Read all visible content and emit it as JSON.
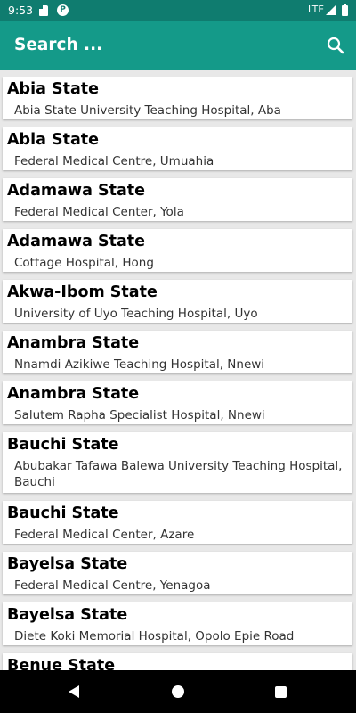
{
  "status_bar": {
    "time": "9:53",
    "network": "LTE",
    "icons": [
      "sd-card-icon",
      "p-notification-icon",
      "signal-icon",
      "battery-icon"
    ]
  },
  "app_bar": {
    "search_placeholder": "Search ...",
    "search_icon": "search-icon",
    "color": "#149a89"
  },
  "hospitals": [
    {
      "state": "Abia State",
      "hospital": "Abia State University Teaching Hospital, Aba"
    },
    {
      "state": "Abia State",
      "hospital": "Federal Medical Centre, Umuahia"
    },
    {
      "state": "Adamawa State",
      "hospital": "Federal Medical Center, Yola"
    },
    {
      "state": "Adamawa State",
      "hospital": "Cottage Hospital, Hong"
    },
    {
      "state": "Akwa-Ibom State",
      "hospital": "University of Uyo Teaching Hospital, Uyo"
    },
    {
      "state": "Anambra State",
      "hospital": "Nnamdi Azikiwe Teaching Hospital, Nnewi"
    },
    {
      "state": "Anambra State",
      "hospital": "Salutem Rapha Specialist Hospital, Nnewi"
    },
    {
      "state": "Bauchi State",
      "hospital": "Abubakar Tafawa Balewa University Teaching Hospital, Bauchi"
    },
    {
      "state": "Bauchi State",
      "hospital": "Federal Medical Center, Azare"
    },
    {
      "state": "Bayelsa State",
      "hospital": "Federal Medical Centre, Yenagoa"
    },
    {
      "state": "Bayelsa State",
      "hospital": "Diete Koki Memorial Hospital, Opolo Epie Road"
    },
    {
      "state": "Benue State",
      "hospital": ""
    }
  ],
  "nav_bar": {
    "icons": [
      "back-icon",
      "home-icon",
      "recents-icon"
    ]
  }
}
